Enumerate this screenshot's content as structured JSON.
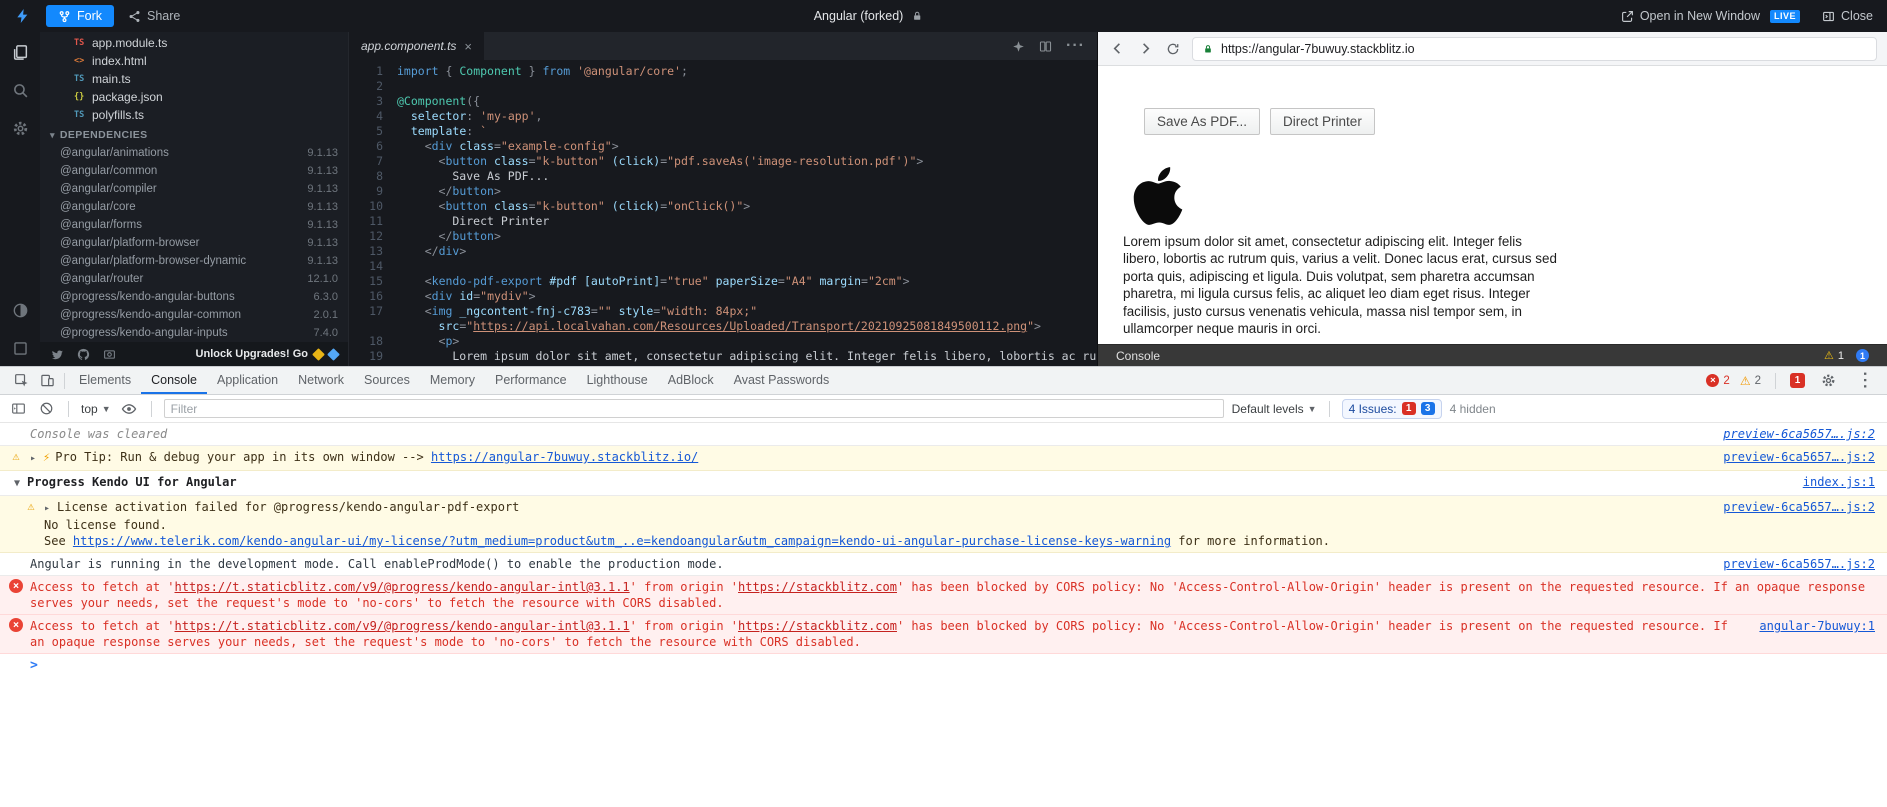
{
  "colors": {
    "accent_blue": "#1389fd",
    "devtools_blue": "#1a73e8",
    "error_red": "#d93025",
    "warning_amber": "#f2a60d",
    "link_blue": "#1558d6"
  },
  "topbar": {
    "fork_label": "Fork",
    "share_label": "Share",
    "project_title": "Angular (forked)",
    "open_new_window_label": "Open in New Window",
    "live_badge": "LIVE",
    "close_label": "Close"
  },
  "sidebar": {
    "files": [
      {
        "name": "app.module.ts",
        "glyph": "TS",
        "color": "#e2574c"
      },
      {
        "name": "index.html",
        "glyph": "<>",
        "color": "#e07c3a"
      },
      {
        "name": "main.ts",
        "glyph": "TS",
        "color": "#519aba"
      },
      {
        "name": "package.json",
        "glyph": "{}",
        "color": "#cbcb41"
      },
      {
        "name": "polyfills.ts",
        "glyph": "TS",
        "color": "#519aba"
      }
    ],
    "dependencies_label": "DEPENDENCIES",
    "dependencies": [
      {
        "name": "@angular/animations",
        "version": "9.1.13"
      },
      {
        "name": "@angular/common",
        "version": "9.1.13"
      },
      {
        "name": "@angular/compiler",
        "version": "9.1.13"
      },
      {
        "name": "@angular/core",
        "version": "9.1.13"
      },
      {
        "name": "@angular/forms",
        "version": "9.1.13"
      },
      {
        "name": "@angular/platform-browser",
        "version": "9.1.13"
      },
      {
        "name": "@angular/platform-browser-dynamic",
        "version": "9.1.13"
      },
      {
        "name": "@angular/router",
        "version": "12.1.0"
      },
      {
        "name": "@progress/kendo-angular-buttons",
        "version": "6.3.0"
      },
      {
        "name": "@progress/kendo-angular-common",
        "version": "2.0.1"
      },
      {
        "name": "@progress/kendo-angular-inputs",
        "version": "7.4.0"
      }
    ],
    "footer": {
      "upgrade_text": "Unlock Upgrades! Go"
    }
  },
  "editor": {
    "tab_name": "app.component.ts",
    "code_lines": [
      {
        "n": "1",
        "t": [
          [
            "kw",
            "import"
          ],
          [
            "d",
            " "
          ],
          [
            "pu",
            "{"
          ],
          [
            "d",
            " "
          ],
          [
            "cl",
            "Component"
          ],
          [
            "d",
            " "
          ],
          [
            "pu",
            "}"
          ],
          [
            "d",
            " "
          ],
          [
            "kw",
            "from"
          ],
          [
            "d",
            " "
          ],
          [
            "st",
            "'@angular/core'"
          ],
          [
            "pu",
            ";"
          ]
        ]
      },
      {
        "n": "2",
        "t": []
      },
      {
        "n": "3",
        "t": [
          [
            "cl",
            "@Component"
          ],
          [
            "pu",
            "({"
          ]
        ]
      },
      {
        "n": "4",
        "t": [
          [
            "d",
            "  "
          ],
          [
            "key",
            "selector"
          ],
          [
            "pu",
            ":"
          ],
          [
            "d",
            " "
          ],
          [
            "st",
            "'my-app'"
          ],
          [
            "pu",
            ","
          ]
        ]
      },
      {
        "n": "5",
        "t": [
          [
            "d",
            "  "
          ],
          [
            "key",
            "template"
          ],
          [
            "pu",
            ":"
          ],
          [
            "d",
            " "
          ],
          [
            "st",
            "`"
          ]
        ]
      },
      {
        "n": "6",
        "t": [
          [
            "d",
            "    "
          ],
          [
            "pu",
            "<"
          ],
          [
            "tg",
            "div"
          ],
          [
            "d",
            " "
          ],
          [
            "at",
            "class"
          ],
          [
            "pu",
            "="
          ],
          [
            "st",
            "\"example-config\""
          ],
          [
            "pu",
            ">"
          ]
        ]
      },
      {
        "n": "7",
        "t": [
          [
            "d",
            "      "
          ],
          [
            "pu",
            "<"
          ],
          [
            "tg",
            "button"
          ],
          [
            "d",
            " "
          ],
          [
            "at",
            "class"
          ],
          [
            "pu",
            "="
          ],
          [
            "st",
            "\"k-button\""
          ],
          [
            "d",
            " "
          ],
          [
            "at",
            "(click)"
          ],
          [
            "pu",
            "="
          ],
          [
            "st",
            "\"pdf.saveAs('image-resolution.pdf')\""
          ],
          [
            "pu",
            ">"
          ]
        ]
      },
      {
        "n": "8",
        "t": [
          [
            "d",
            "        Save As PDF..."
          ]
        ]
      },
      {
        "n": "9",
        "t": [
          [
            "d",
            "      "
          ],
          [
            "pu",
            "</"
          ],
          [
            "tg",
            "button"
          ],
          [
            "pu",
            ">"
          ]
        ]
      },
      {
        "n": "10",
        "t": [
          [
            "d",
            "      "
          ],
          [
            "pu",
            "<"
          ],
          [
            "tg",
            "button"
          ],
          [
            "d",
            " "
          ],
          [
            "at",
            "class"
          ],
          [
            "pu",
            "="
          ],
          [
            "st",
            "\"k-button\""
          ],
          [
            "d",
            " "
          ],
          [
            "at",
            "(click)"
          ],
          [
            "pu",
            "="
          ],
          [
            "st",
            "\"onClick()\""
          ],
          [
            "pu",
            ">"
          ]
        ]
      },
      {
        "n": "11",
        "t": [
          [
            "d",
            "        Direct Printer"
          ]
        ]
      },
      {
        "n": "12",
        "t": [
          [
            "d",
            "      "
          ],
          [
            "pu",
            "</"
          ],
          [
            "tg",
            "button"
          ],
          [
            "pu",
            ">"
          ]
        ]
      },
      {
        "n": "13",
        "t": [
          [
            "d",
            "    "
          ],
          [
            "pu",
            "</"
          ],
          [
            "tg",
            "div"
          ],
          [
            "pu",
            ">"
          ]
        ]
      },
      {
        "n": "14",
        "t": []
      },
      {
        "n": "15",
        "t": [
          [
            "d",
            "    "
          ],
          [
            "pu",
            "<"
          ],
          [
            "tg",
            "kendo-pdf-export"
          ],
          [
            "d",
            " "
          ],
          [
            "at",
            "#pdf"
          ],
          [
            "d",
            " "
          ],
          [
            "at",
            "[autoPrint]"
          ],
          [
            "pu",
            "="
          ],
          [
            "st",
            "\"true\""
          ],
          [
            "d",
            " "
          ],
          [
            "at",
            "paperSize"
          ],
          [
            "pu",
            "="
          ],
          [
            "st",
            "\"A4\""
          ],
          [
            "d",
            " "
          ],
          [
            "at",
            "margin"
          ],
          [
            "pu",
            "="
          ],
          [
            "st",
            "\"2cm\""
          ],
          [
            "pu",
            ">"
          ]
        ]
      },
      {
        "n": "16",
        "t": [
          [
            "d",
            "    "
          ],
          [
            "pu",
            "<"
          ],
          [
            "tg",
            "div"
          ],
          [
            "d",
            " "
          ],
          [
            "at",
            "id"
          ],
          [
            "pu",
            "="
          ],
          [
            "st",
            "\"mydiv\""
          ],
          [
            "pu",
            ">"
          ]
        ]
      },
      {
        "n": "17",
        "t": [
          [
            "d",
            "    "
          ],
          [
            "pu",
            "<"
          ],
          [
            "tg",
            "img"
          ],
          [
            "d",
            " "
          ],
          [
            "at",
            "_ngcontent-fnj-c783"
          ],
          [
            "pu",
            "="
          ],
          [
            "st",
            "\"\""
          ],
          [
            "d",
            " "
          ],
          [
            "at",
            "style"
          ],
          [
            "pu",
            "="
          ],
          [
            "st",
            "\"width: 84px;\""
          ]
        ]
      },
      {
        "n": "",
        "t": [
          [
            "d",
            "      "
          ],
          [
            "at",
            "src"
          ],
          [
            "pu",
            "="
          ],
          [
            "st",
            "\""
          ],
          [
            "lk",
            "https://api.localvahan.com/Resources/Uploaded/Transport/20210925081849500112.png"
          ],
          [
            "st",
            "\""
          ],
          [
            "pu",
            ">"
          ]
        ]
      },
      {
        "n": "18",
        "t": [
          [
            "d",
            "      "
          ],
          [
            "pu",
            "<"
          ],
          [
            "tg",
            "p"
          ],
          [
            "pu",
            ">"
          ]
        ]
      },
      {
        "n": "19",
        "t": [
          [
            "d",
            "        Lorem ipsum dolor sit amet, consectetur adipiscing elit. Integer felis libero, lobortis ac rutrum"
          ]
        ]
      }
    ]
  },
  "preview": {
    "url": "https://angular-7buwuy.stackblitz.io",
    "save_pdf_button": "Save As PDF...",
    "direct_printer_button": "Direct Printer",
    "paragraph": "Lorem ipsum dolor sit amet, consectetur adipiscing elit. Integer felis libero, lobortis ac rutrum quis, varius a velit. Donec lacus erat, cursus sed porta quis, adipiscing et ligula. Duis volutpat, sem pharetra accumsan pharetra, mi ligula cursus felis, ac aliquet leo diam eget risus. Integer facilisis, justo cursus venenatis vehicula, massa nisl tempor sem, in ullamcorper neque mauris in orci.",
    "console_strip": {
      "label": "Console",
      "warning_count": "1",
      "info_count": "1"
    }
  },
  "devtools": {
    "tabs": [
      "Elements",
      "Console",
      "Application",
      "Network",
      "Sources",
      "Memory",
      "Performance",
      "Lighthouse",
      "AdBlock",
      "Avast Passwords"
    ],
    "active_tab": "Console",
    "error_count": "2",
    "warning_count": "2",
    "issues_badge": "1",
    "toolbar": {
      "context_label": "top",
      "filter_placeholder": "Filter",
      "levels_label": "Default levels",
      "issues_label": "4 Issues:",
      "issues_red": "1",
      "issues_blue": "3",
      "hidden_label": "4 hidden"
    },
    "console_rows": [
      {
        "type": "cleared",
        "segments": [
          [
            "t",
            "Console was cleared"
          ]
        ],
        "source": "preview-6ca5657….js:2"
      },
      {
        "type": "warn",
        "arrow": "▸",
        "bolt": true,
        "segments": [
          [
            "t",
            "Pro Tip: Run & debug your app in its own window --> "
          ],
          [
            "lk",
            "https://angular-7buwuy.stackblitz.io/"
          ]
        ],
        "source": "preview-6ca5657….js:2"
      },
      {
        "type": "group",
        "arrow": "▼",
        "segments": [
          [
            "t",
            "Progress Kendo UI for Angular"
          ]
        ],
        "source": "index.js:1"
      },
      {
        "type": "warn",
        "arrow": "▸",
        "indent": true,
        "segments": [
          [
            "t",
            "License activation failed for @progress/kendo-angular-pdf-export\nNo license found.\nSee "
          ],
          [
            "lk",
            "https://www.telerik.com/kendo-angular-ui/my-license/?utm_medium=product&utm_..e=kendoangular&utm_campaign=kendo-ui-angular-purchase-license-keys-warning"
          ],
          [
            "t",
            " for more information."
          ]
        ],
        "source": "preview-6ca5657….js:2"
      },
      {
        "type": "log",
        "segments": [
          [
            "t",
            "Angular is running in the development mode. Call enableProdMode() to enable the production mode."
          ]
        ],
        "source": "preview-6ca5657….js:2"
      },
      {
        "type": "error",
        "segments": [
          [
            "t",
            "Access to fetch at '"
          ],
          [
            "lk",
            "https://t.staticblitz.com/v9/@progress/kendo-angular-intl@3.1.1"
          ],
          [
            "t",
            "' from origin '"
          ],
          [
            "lk",
            "https://stackblitz.com"
          ],
          [
            "t",
            "' has been blocked by CORS policy: No 'Access-Control-Allow-Origin' header is present on the requested resource. If an opaque response serves your needs, set the request's mode to 'no-cors' to fetch the resource with CORS disabled."
          ]
        ],
        "source": ""
      },
      {
        "type": "error",
        "segments": [
          [
            "t",
            "Access to fetch at '"
          ],
          [
            "lk",
            "https://t.staticblitz.com/v9/@progress/kendo-angular-intl@3.1.1"
          ],
          [
            "t",
            "' from origin '"
          ],
          [
            "lk",
            "https://stackblitz.com"
          ],
          [
            "t",
            "' has been blocked by CORS policy: No 'Access-Control-Allow-Origin' header is present on the requested resource. If an opaque response serves your needs, set the request's mode to 'no-cors' to fetch the resource with CORS disabled."
          ]
        ],
        "source": "angular-7buwuy:1"
      },
      {
        "type": "prompt"
      }
    ]
  }
}
